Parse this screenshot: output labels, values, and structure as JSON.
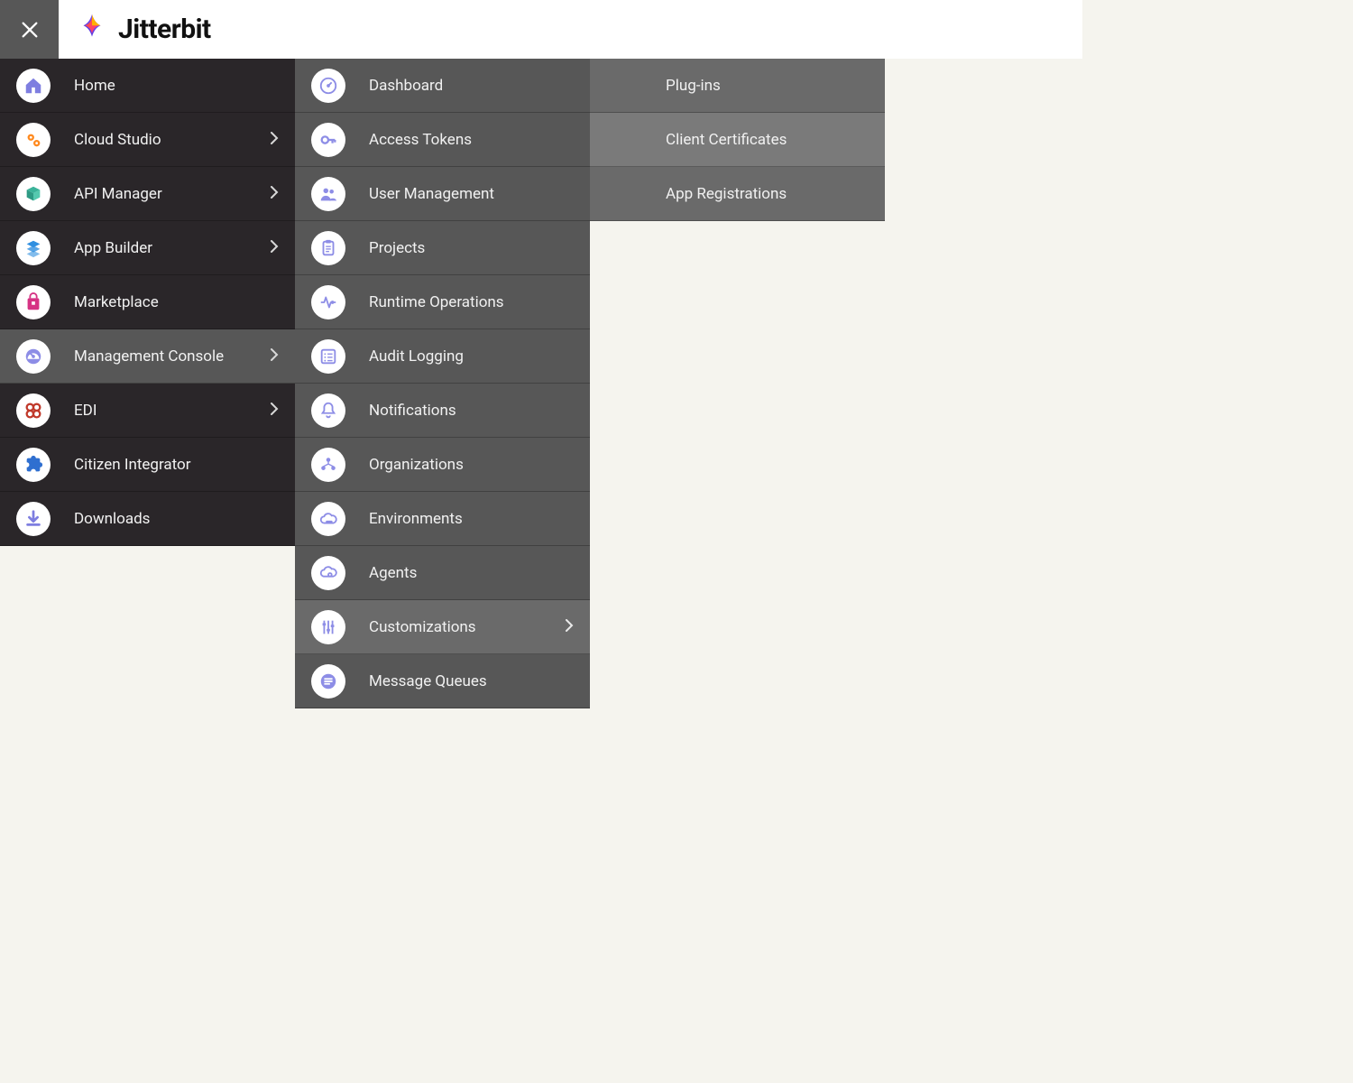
{
  "brand": {
    "name": "Jitterbit"
  },
  "col1": {
    "items": [
      {
        "label": "Home",
        "icon": "home",
        "chevron": false
      },
      {
        "label": "Cloud Studio",
        "icon": "gears",
        "chevron": true
      },
      {
        "label": "API Manager",
        "icon": "cube",
        "chevron": true
      },
      {
        "label": "App Builder",
        "icon": "layers",
        "chevron": true
      },
      {
        "label": "Marketplace",
        "icon": "bag",
        "chevron": false
      },
      {
        "label": "Management Console",
        "icon": "gauge",
        "chevron": true,
        "active": true
      },
      {
        "label": "EDI",
        "icon": "links",
        "chevron": true
      },
      {
        "label": "Citizen Integrator",
        "icon": "puzzle",
        "chevron": false
      },
      {
        "label": "Downloads",
        "icon": "download",
        "chevron": false
      }
    ]
  },
  "col2": {
    "items": [
      {
        "label": "Dashboard",
        "icon": "speedometer"
      },
      {
        "label": "Access Tokens",
        "icon": "key"
      },
      {
        "label": "User Management",
        "icon": "users"
      },
      {
        "label": "Projects",
        "icon": "clipboard"
      },
      {
        "label": "Runtime Operations",
        "icon": "activity"
      },
      {
        "label": "Audit Logging",
        "icon": "list"
      },
      {
        "label": "Notifications",
        "icon": "bell"
      },
      {
        "label": "Organizations",
        "icon": "org"
      },
      {
        "label": "Environments",
        "icon": "cloud"
      },
      {
        "label": "Agents",
        "icon": "cloud-gear"
      },
      {
        "label": "Customizations",
        "icon": "sliders",
        "chevron": true,
        "active": true
      },
      {
        "label": "Message Queues",
        "icon": "queue"
      }
    ]
  },
  "col3": {
    "items": [
      {
        "label": "Plug-ins"
      },
      {
        "label": "Client Certificates",
        "active": true
      },
      {
        "label": "App Registrations"
      }
    ]
  }
}
